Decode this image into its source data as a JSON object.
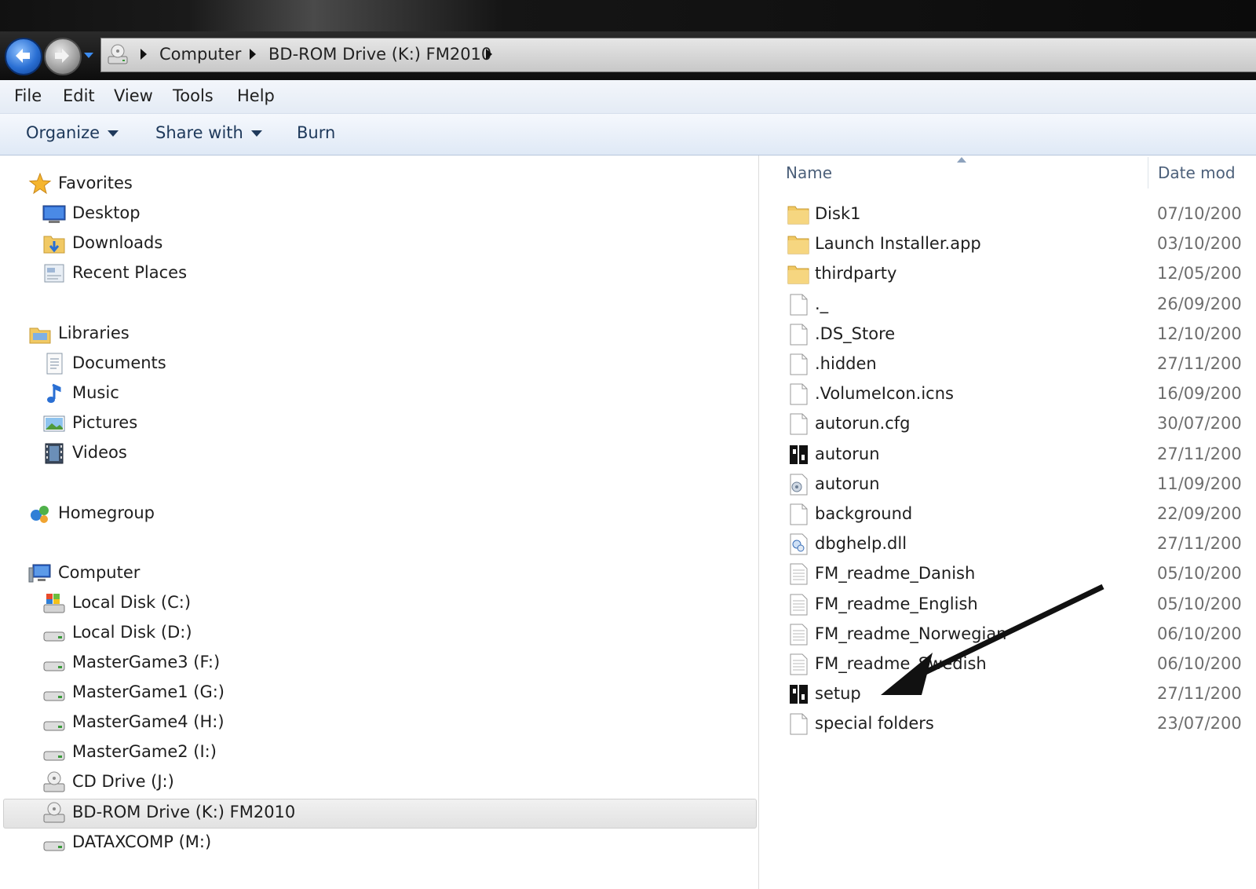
{
  "address_bar": {
    "crumbs": [
      "Computer",
      "BD-ROM Drive (K:) FM2010"
    ]
  },
  "menubar": {
    "file": "File",
    "edit": "Edit",
    "view": "View",
    "tools": "Tools",
    "help": "Help"
  },
  "toolbar": {
    "organize": "Organize",
    "share_with": "Share with",
    "burn": "Burn"
  },
  "nav": {
    "favorites": {
      "label": "Favorites",
      "items": [
        "Desktop",
        "Downloads",
        "Recent Places"
      ]
    },
    "libraries": {
      "label": "Libraries",
      "items": [
        "Documents",
        "Music",
        "Pictures",
        "Videos"
      ]
    },
    "homegroup": "Homegroup",
    "computer": {
      "label": "Computer",
      "items": [
        "Local Disk (C:)",
        "Local Disk (D:)",
        "MasterGame3 (F:)",
        "MasterGame1 (G:)",
        "MasterGame4 (H:)",
        "MasterGame2 (I:)",
        "CD Drive (J:)",
        "BD-ROM Drive (K:) FM2010",
        "DATAXCOMP (M:)"
      ],
      "selected": "BD-ROM Drive (K:) FM2010"
    }
  },
  "columns": {
    "name": "Name",
    "date": "Date mod"
  },
  "files": [
    {
      "name": "Disk1",
      "date": "07/10/200",
      "icon": "folder-icon"
    },
    {
      "name": "Launch Installer.app",
      "date": "03/10/200",
      "icon": "folder-icon"
    },
    {
      "name": "thirdparty",
      "date": "12/05/200",
      "icon": "folder-icon"
    },
    {
      "name": "._",
      "date": "26/09/200",
      "icon": "file-icon"
    },
    {
      "name": ".DS_Store",
      "date": "12/10/200",
      "icon": "file-icon"
    },
    {
      "name": ".hidden",
      "date": "27/11/200",
      "icon": "file-icon"
    },
    {
      "name": ".VolumeIcon.icns",
      "date": "16/09/200",
      "icon": "file-icon"
    },
    {
      "name": "autorun.cfg",
      "date": "30/07/200",
      "icon": "file-icon"
    },
    {
      "name": "autorun",
      "date": "27/11/200",
      "icon": "app-icon"
    },
    {
      "name": "autorun",
      "date": "11/09/200",
      "icon": "settings-file-icon"
    },
    {
      "name": "background",
      "date": "22/09/200",
      "icon": "file-icon"
    },
    {
      "name": "dbghelp.dll",
      "date": "27/11/200",
      "icon": "dll-icon"
    },
    {
      "name": "FM_readme_Danish",
      "date": "05/10/200",
      "icon": "text-file-icon"
    },
    {
      "name": "FM_readme_English",
      "date": "05/10/200",
      "icon": "text-file-icon"
    },
    {
      "name": "FM_readme_Norwegian",
      "date": "06/10/200",
      "icon": "text-file-icon"
    },
    {
      "name": "FM_readme_Swedish",
      "date": "06/10/200",
      "icon": "text-file-icon"
    },
    {
      "name": "setup",
      "date": "27/11/200",
      "icon": "app-icon"
    },
    {
      "name": "special folders",
      "date": "23/07/200",
      "icon": "file-icon"
    }
  ],
  "annotation": {
    "points_to": "setup"
  },
  "colors": {
    "toolbar_text": "#1e395b",
    "selection_bg": "#e6e6e6",
    "back_button": "#2a6fd3"
  }
}
